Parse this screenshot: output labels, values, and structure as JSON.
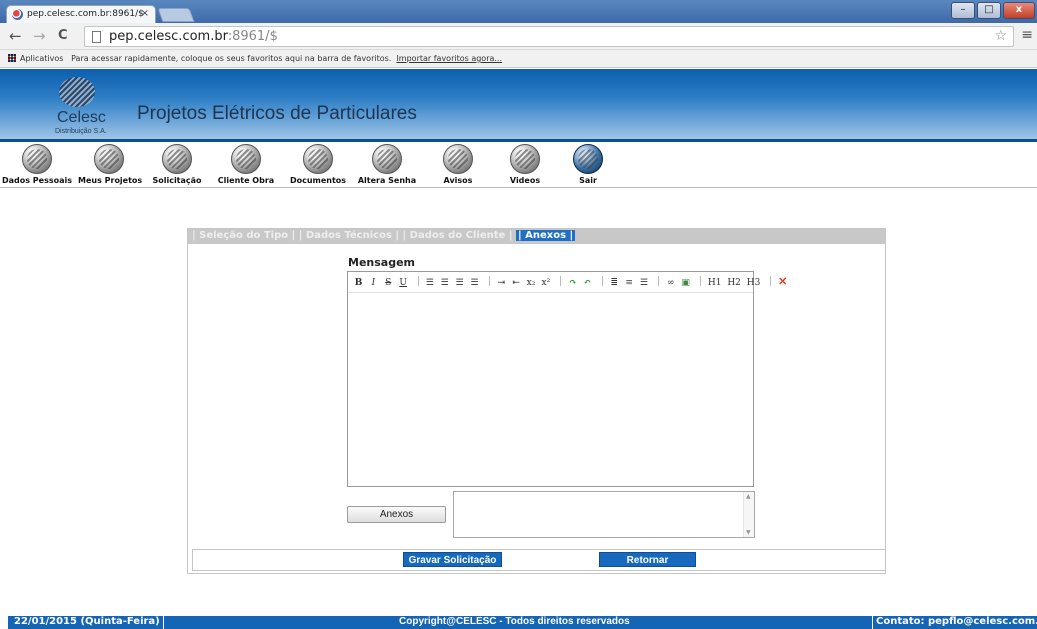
{
  "browser": {
    "tab_title": "pep.celesc.com.br:8961/$",
    "tab_close": "×",
    "url_host": "pep.celesc.com.br",
    "url_rest": ":8961/$",
    "back": "←",
    "forward": "→",
    "reload": "C",
    "star": "☆",
    "menu": "≡",
    "win_min": "–",
    "win_max": "□",
    "win_close": "x"
  },
  "bookmarks": {
    "apps_label": "Aplicativos",
    "hint": "Para acessar rapidamente, coloque os seus favoritos aqui na barra de favoritos.",
    "import_link": "Importar favoritos agora..."
  },
  "header": {
    "logo_name": "Celesc",
    "logo_sub": "Distribuição S.A.",
    "title": "Projetos Elétricos de Particulares"
  },
  "menu": [
    {
      "label": "Dados Pessoais"
    },
    {
      "label": "Meus Projetos"
    },
    {
      "label": "Solicitação"
    },
    {
      "label": "Cliente Obra"
    },
    {
      "label": "Documentos"
    },
    {
      "label": "Altera Senha"
    },
    {
      "label": "Avisos"
    },
    {
      "label": "Videos"
    },
    {
      "label": "Sair"
    }
  ],
  "steps": [
    {
      "label": "| Seleção do Tipo |"
    },
    {
      "label": "| Dados Técnicos |"
    },
    {
      "label": "| Dados do Cliente |"
    },
    {
      "label": "| Anexos |"
    }
  ],
  "form": {
    "message_label": "Mensagem",
    "attach_button": "Anexos",
    "save_button": "Gravar Solicitação",
    "back_button": "Retornar"
  },
  "editor_toolbar": {
    "bold": "B",
    "italic": "I",
    "strike": "S",
    "underline": "U",
    "sub": "x₂",
    "sup": "x²",
    "h1": "H1",
    "h2": "H2",
    "h3": "H3"
  },
  "footer": {
    "date": "22/01/2015 (Quinta-Feira)",
    "copyright": "Copyright@CELESC - Todos direitos reservados",
    "contact": "Contato: pepflo@celesc.com.b"
  }
}
